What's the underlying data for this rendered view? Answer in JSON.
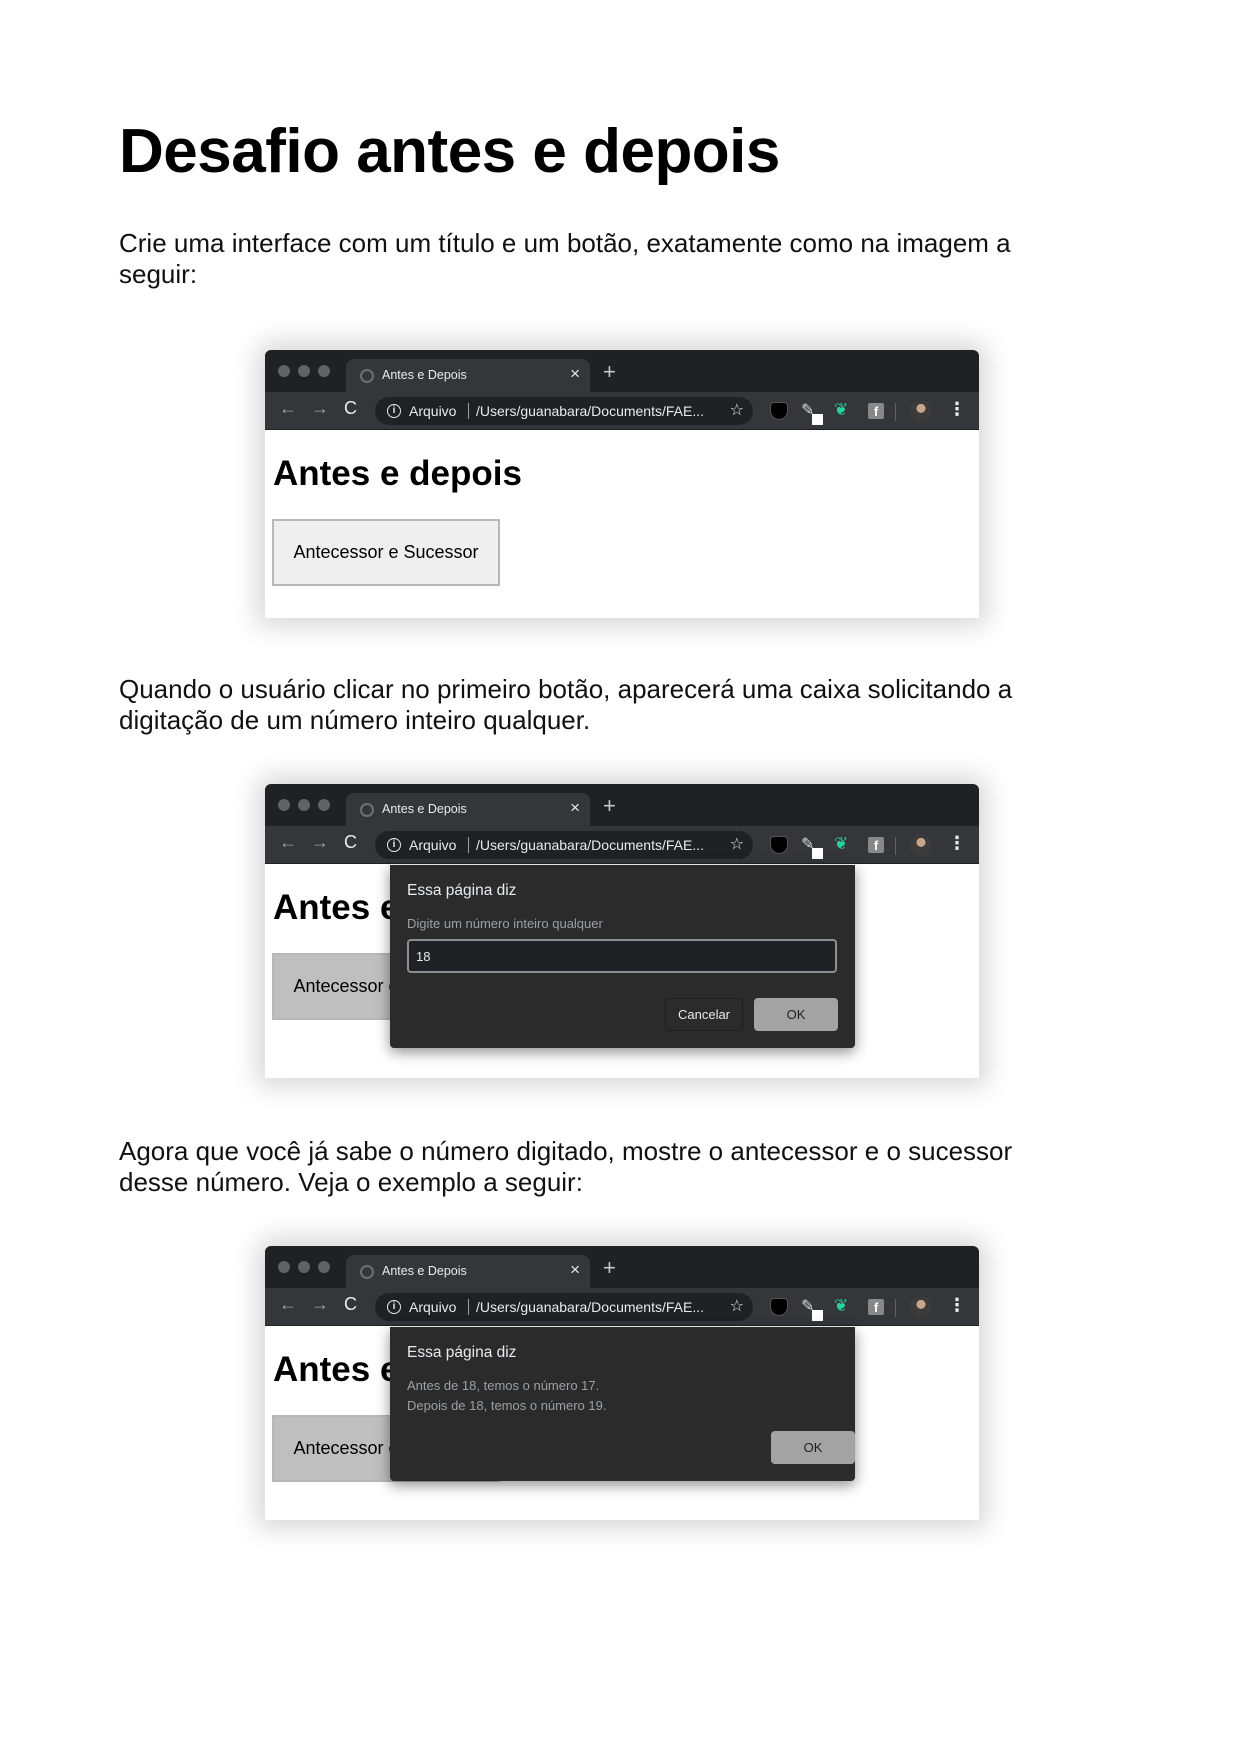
{
  "document": {
    "title": "Desafio antes e depois",
    "paragraph_1": "Crie uma interface com um título e um botão, exatamente como na imagem a seguir:",
    "paragraph_2": "Quando o usuário clicar no primeiro botão, aparecerá uma caixa solicitando a digitação de um número inteiro qualquer.",
    "paragraph_3": "Agora que você já sabe o número digitado, mostre o antecessor e o sucessor desse número. Veja o exemplo a seguir:"
  },
  "browser": {
    "tab_title": "Antes e Depois",
    "tab_close": "×",
    "new_tab": "+",
    "back": "←",
    "forward": "→",
    "reload": "C",
    "info": "i",
    "omnibox_label": "Arquivo",
    "url": "/Users/guanabara/Documents/FAE...",
    "star": "☆",
    "menu": "⋮",
    "extension_icons": [
      "shield-icon",
      "pen-icon",
      "bird-icon",
      "facebook-icon",
      "avatar"
    ]
  },
  "page": {
    "heading": "Antes e depois",
    "button_label": "Antecessor e Sucessor"
  },
  "prompt_dialog": {
    "title": "Essa página diz",
    "message": "Digite um número inteiro qualquer",
    "input_value": "18",
    "cancel_label": "Cancelar",
    "ok_label": "OK"
  },
  "alert_dialog": {
    "title": "Essa página diz",
    "line_1": "Antes de 18, temos o número 17.",
    "line_2": "Depois de 18, temos o número 19.",
    "ok_label": "OK"
  },
  "colors": {
    "titlebar": "#202124",
    "toolbar": "#35363a",
    "dialog": "#2b2b2b",
    "extension_green": "#28d39a"
  }
}
